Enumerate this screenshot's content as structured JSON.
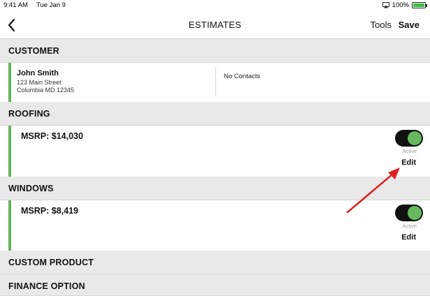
{
  "status_bar": {
    "time": "9:41 AM",
    "date": "Tue Jan 9",
    "battery": "100%",
    "airplay_icon": "airplay-icon",
    "battery_icon": "battery-icon"
  },
  "nav": {
    "back_icon": "chevron-left-icon",
    "title": "ESTIMATES",
    "tools_label": "Tools",
    "save_label": "Save"
  },
  "customer": {
    "header": "CUSTOMER",
    "name": "John Smith",
    "address_line1": "123 Main Street",
    "address_line2": "Columbia MD 12345",
    "contacts": "No Contacts"
  },
  "roofing": {
    "header": "ROOFING",
    "msrp": "MSRP: $14,030",
    "toggle_label": "Active",
    "toggle_on": true,
    "edit_label": "Edit"
  },
  "windows": {
    "header": "WINDOWS",
    "msrp": "MSRP: $8,419",
    "toggle_label": "Active",
    "toggle_on": true,
    "edit_label": "Edit"
  },
  "custom_product": {
    "header": "CUSTOM PRODUCT"
  },
  "finance_option": {
    "header": "FINANCE OPTION"
  },
  "colors": {
    "accent_green": "#63b35b",
    "toggle_knob": "#66b95c",
    "section_bg": "#e9e9ea",
    "annotation_arrow": "#e02020"
  }
}
